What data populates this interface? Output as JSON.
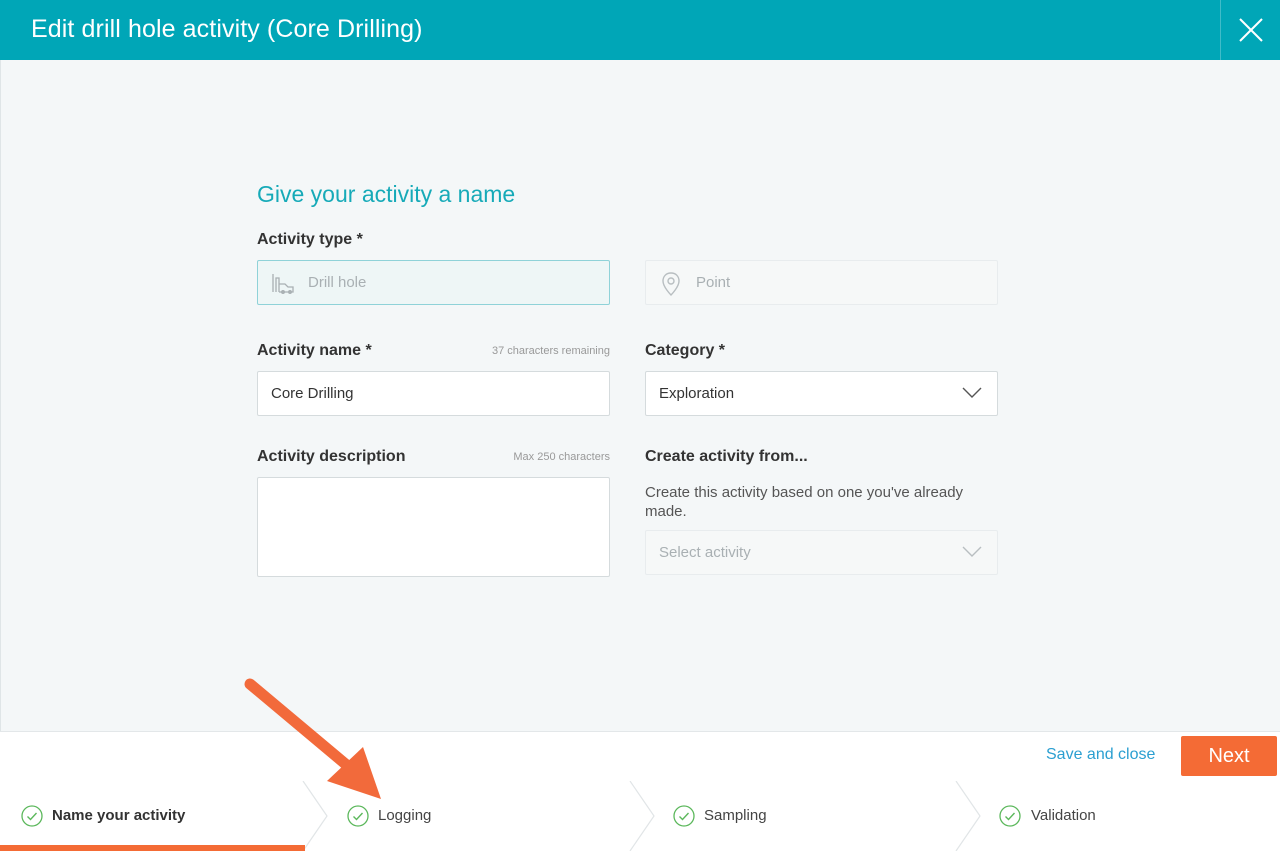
{
  "header": {
    "title": "Edit drill hole activity (Core Drilling)"
  },
  "form": {
    "section_title": "Give your activity a name",
    "activity_type": {
      "label": "Activity type *",
      "options": [
        {
          "label": "Drill hole",
          "icon": "drill-rig-icon",
          "selected": true
        },
        {
          "label": "Point",
          "icon": "map-pin-icon",
          "selected": false
        }
      ]
    },
    "activity_name": {
      "label": "Activity name *",
      "hint": "37 characters remaining",
      "value": "Core Drilling"
    },
    "category": {
      "label": "Category *",
      "value": "Exploration"
    },
    "activity_description": {
      "label": "Activity description",
      "hint": "Max 250 characters",
      "value": ""
    },
    "create_from": {
      "label": "Create activity from...",
      "description": "Create this activity based on one you've already made.",
      "placeholder": "Select activity"
    }
  },
  "footer": {
    "save_label": "Save and close",
    "next_label": "Next"
  },
  "steps": [
    {
      "label": "Name your activity",
      "active": true,
      "completed": true
    },
    {
      "label": "Logging",
      "active": false,
      "completed": true
    },
    {
      "label": "Sampling",
      "active": false,
      "completed": true
    },
    {
      "label": "Validation",
      "active": false,
      "completed": true
    }
  ],
  "colors": {
    "header": "#00a6b7",
    "accent": "#16aab8",
    "primary_button": "#f46b35",
    "link": "#2b9fd1",
    "check": "#5cb85c"
  }
}
